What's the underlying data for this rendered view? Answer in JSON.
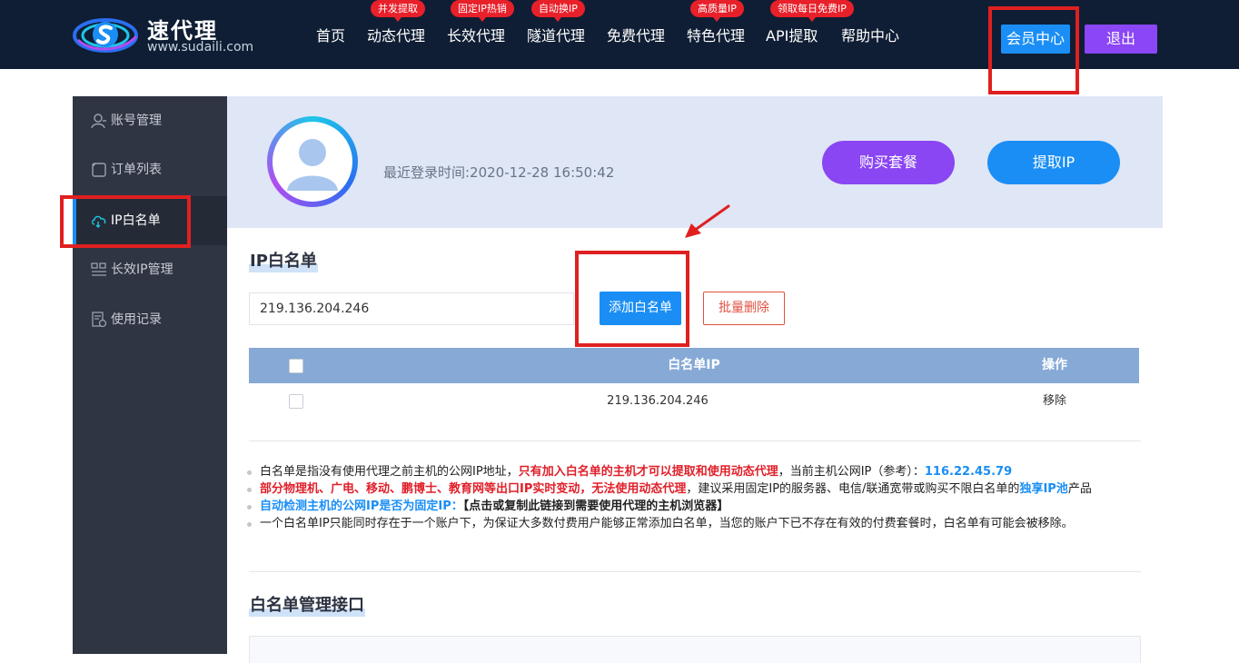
{
  "header": {
    "brand_name": "速代理",
    "brand_url": "www.sudaili.com",
    "nav": [
      {
        "label": "首页",
        "badge": ""
      },
      {
        "label": "动态代理",
        "badge": "并发提取"
      },
      {
        "label": "长效代理",
        "badge": "固定IP热销"
      },
      {
        "label": "隧道代理",
        "badge": "自动换IP"
      },
      {
        "label": "免费代理",
        "badge": ""
      },
      {
        "label": "特色代理",
        "badge": "高质量IP"
      },
      {
        "label": "API提取",
        "badge": "领取每日免费IP"
      },
      {
        "label": "帮助中心",
        "badge": ""
      }
    ],
    "member_center": "会员中心",
    "logout": "退出"
  },
  "sidebar": {
    "items": [
      {
        "label": "账号管理",
        "icon": "user-icon"
      },
      {
        "label": "订单列表",
        "icon": "document-icon"
      },
      {
        "label": "IP白名单",
        "icon": "cloud-icon",
        "active": true
      },
      {
        "label": "长效IP管理",
        "icon": "grid-icon"
      },
      {
        "label": "使用记录",
        "icon": "record-icon"
      }
    ]
  },
  "profile": {
    "login_time": "最近登录时间:2020-12-28 16:50:42",
    "buy_package": "购买套餐",
    "extract_ip": "提取IP"
  },
  "whitelist": {
    "title": "IP白名单",
    "input_value": "219.136.204.246",
    "add_button": "添加白名单",
    "batch_delete": "批量删除",
    "table": {
      "col_ip": "白名单IP",
      "col_action": "操作",
      "rows": [
        {
          "ip": "219.136.204.246",
          "action": "移除"
        }
      ]
    }
  },
  "notes": {
    "n1_a": "白名单是指没有使用代理之前主机的公网IP地址，",
    "n1_b": "只有加入白名单的主机才可以提取和使用动态代理",
    "n1_c": "，当前主机公网IP（参考）：",
    "n1_d": "116.22.45.79",
    "n2_a": "部分物理机、广电、移动、鹏博士、教育网等出口IP实时变动，无法使用动态代理",
    "n2_b": "，建议采用固定IP的服务器、电信/联通宽带或购买不限白名单的",
    "n2_c": "独享IP池",
    "n2_d": "产品",
    "n3_a": "自动检测主机的公网IP是否为固定IP：",
    "n3_b": "【点击或复制此链接到需要使用代理的主机浏览器】",
    "n4": "一个白名单IP只能同时存在于一个账户下，为保证大多数付费用户能够正常添加白名单，当您的账户下已不存在有效的付费套餐时，白名单有可能会被移除。"
  },
  "api_section": {
    "title": "白名单管理接口"
  },
  "colors": {
    "topbar": "#0f1e34",
    "accent_blue": "#1a8ef5",
    "accent_purple": "#8b46f5",
    "highlight_red": "#e02020"
  }
}
